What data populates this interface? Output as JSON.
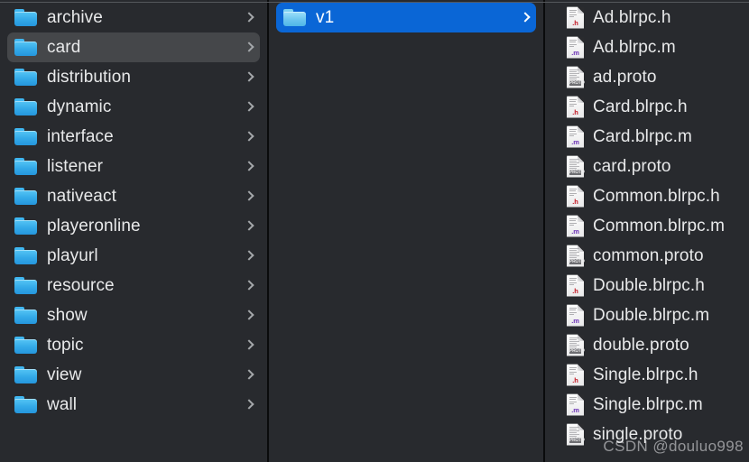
{
  "window": {
    "view_mode": "column",
    "background_color": "#282a2e",
    "selection_active_color": "#0a66d6",
    "selection_inactive_color": "#45474a",
    "divider_color": "#0a0b0c",
    "text_color": "#e8e9ea"
  },
  "watermark": {
    "text": "CSDN @douluo998"
  },
  "columns": {
    "folders": {
      "items": [
        {
          "name": "archive",
          "icon": "folder-icon",
          "chevron": "chevron-right-icon",
          "selected": false
        },
        {
          "name": "card",
          "icon": "folder-icon",
          "chevron": "chevron-right-icon",
          "selected": true
        },
        {
          "name": "distribution",
          "icon": "folder-icon",
          "chevron": "chevron-right-icon",
          "selected": false
        },
        {
          "name": "dynamic",
          "icon": "folder-icon",
          "chevron": "chevron-right-icon",
          "selected": false
        },
        {
          "name": "interface",
          "icon": "folder-icon",
          "chevron": "chevron-right-icon",
          "selected": false
        },
        {
          "name": "listener",
          "icon": "folder-icon",
          "chevron": "chevron-right-icon",
          "selected": false
        },
        {
          "name": "nativeact",
          "icon": "folder-icon",
          "chevron": "chevron-right-icon",
          "selected": false
        },
        {
          "name": "playeronline",
          "icon": "folder-icon",
          "chevron": "chevron-right-icon",
          "selected": false
        },
        {
          "name": "playurl",
          "icon": "folder-icon",
          "chevron": "chevron-right-icon",
          "selected": false
        },
        {
          "name": "resource",
          "icon": "folder-icon",
          "chevron": "chevron-right-icon",
          "selected": false
        },
        {
          "name": "show",
          "icon": "folder-icon",
          "chevron": "chevron-right-icon",
          "selected": false
        },
        {
          "name": "topic",
          "icon": "folder-icon",
          "chevron": "chevron-right-icon",
          "selected": false
        },
        {
          "name": "view",
          "icon": "folder-icon",
          "chevron": "chevron-right-icon",
          "selected": false
        },
        {
          "name": "wall",
          "icon": "folder-icon",
          "chevron": "chevron-right-icon",
          "selected": false
        }
      ]
    },
    "versions": {
      "items": [
        {
          "name": "v1",
          "icon": "folder-icon",
          "chevron": "chevron-right-icon",
          "selected": true
        }
      ]
    },
    "files": {
      "items": [
        {
          "name": "Ad.blrpc.h",
          "icon": "h-file-icon",
          "ext_label": ".h"
        },
        {
          "name": "Ad.blrpc.m",
          "icon": "m-file-icon",
          "ext_label": ".m"
        },
        {
          "name": "ad.proto",
          "icon": "proto-file-icon",
          "ext_label": "PROTO"
        },
        {
          "name": "Card.blrpc.h",
          "icon": "h-file-icon",
          "ext_label": ".h"
        },
        {
          "name": "Card.blrpc.m",
          "icon": "m-file-icon",
          "ext_label": ".m"
        },
        {
          "name": "card.proto",
          "icon": "proto-file-icon",
          "ext_label": "PROTO"
        },
        {
          "name": "Common.blrpc.h",
          "icon": "h-file-icon",
          "ext_label": ".h"
        },
        {
          "name": "Common.blrpc.m",
          "icon": "m-file-icon",
          "ext_label": ".m"
        },
        {
          "name": "common.proto",
          "icon": "proto-file-icon",
          "ext_label": "PROTO"
        },
        {
          "name": "Double.blrpc.h",
          "icon": "h-file-icon",
          "ext_label": ".h"
        },
        {
          "name": "Double.blrpc.m",
          "icon": "m-file-icon",
          "ext_label": ".m"
        },
        {
          "name": "double.proto",
          "icon": "proto-file-icon",
          "ext_label": "PROTO"
        },
        {
          "name": "Single.blrpc.h",
          "icon": "h-file-icon",
          "ext_label": ".h"
        },
        {
          "name": "Single.blrpc.m",
          "icon": "m-file-icon",
          "ext_label": ".m"
        },
        {
          "name": "single.proto",
          "icon": "proto-file-icon",
          "ext_label": "PROTO"
        }
      ]
    }
  }
}
